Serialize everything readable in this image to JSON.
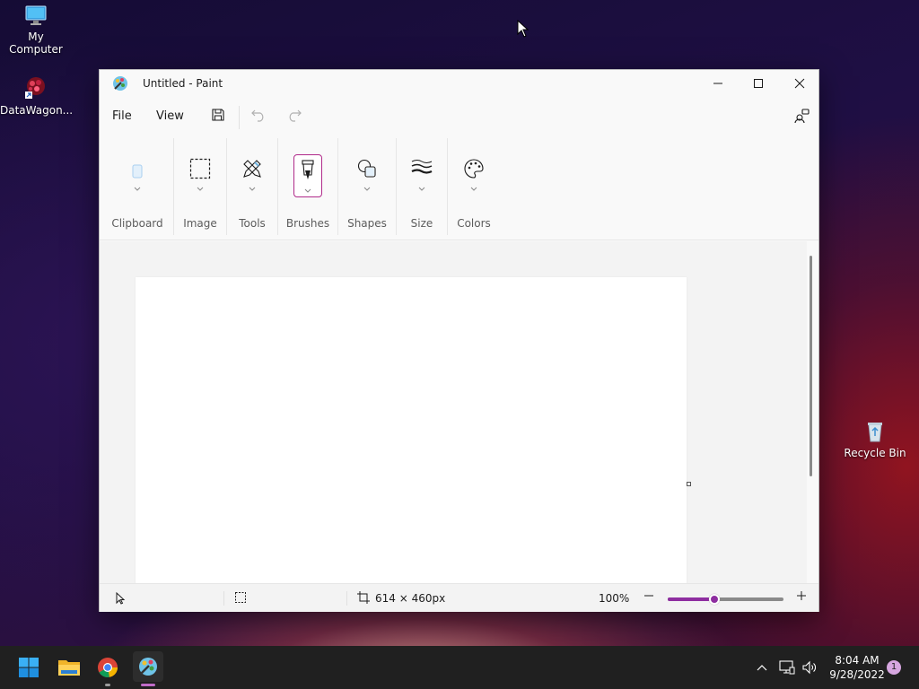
{
  "desktop": {
    "icons": [
      {
        "label": "My Computer"
      },
      {
        "label": "DataWagon..."
      },
      {
        "label": "Recycle Bin"
      }
    ]
  },
  "window": {
    "title": "Untitled - Paint",
    "menu": {
      "file": "File",
      "view": "View"
    },
    "ribbon": {
      "groups": [
        {
          "label": "Clipboard"
        },
        {
          "label": "Image"
        },
        {
          "label": "Tools"
        },
        {
          "label": "Brushes"
        },
        {
          "label": "Shapes"
        },
        {
          "label": "Size"
        },
        {
          "label": "Colors"
        }
      ]
    },
    "status": {
      "canvas_size": "614 × 460px",
      "zoom": "100%",
      "zoom_slider_fraction": 0.4
    },
    "accent_color": "#8e2ea0"
  },
  "taskbar": {
    "time": "8:04 AM",
    "date": "9/28/2022",
    "notification_count": "1"
  }
}
